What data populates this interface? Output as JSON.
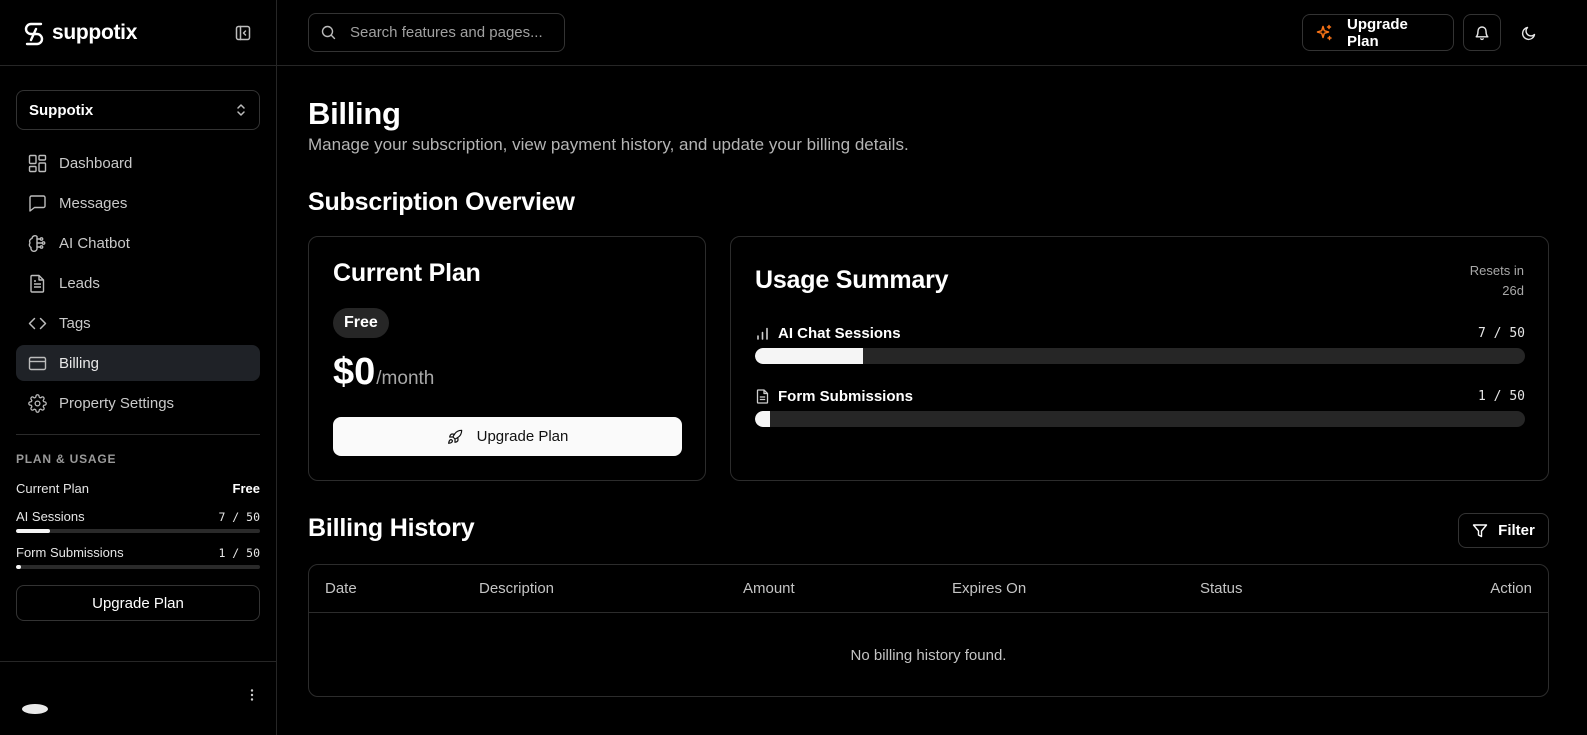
{
  "brand": {
    "name": "suppotix"
  },
  "workspace": {
    "name": "Suppotix"
  },
  "nav": [
    {
      "label": "Dashboard",
      "icon": "dashboard-icon"
    },
    {
      "label": "Messages",
      "icon": "message-square-icon"
    },
    {
      "label": "AI Chatbot",
      "icon": "brain-icon"
    },
    {
      "label": "Leads",
      "icon": "file-text-icon"
    },
    {
      "label": "Tags",
      "icon": "code-icon"
    },
    {
      "label": "Billing",
      "icon": "credit-card-icon",
      "active": true
    },
    {
      "label": "Property Settings",
      "icon": "gear-icon"
    }
  ],
  "plan_usage": {
    "title": "PLAN & USAGE",
    "current_plan_label": "Current Plan",
    "current_plan_value": "Free",
    "ai_sessions_label": "AI Sessions",
    "ai_sessions_value": "7 / 50",
    "ai_sessions_fraction": 0.14,
    "form_submissions_label": "Form Submissions",
    "form_submissions_value": "1 / 50",
    "form_submissions_fraction": 0.02,
    "upgrade_label": "Upgrade Plan"
  },
  "header": {
    "search_placeholder": "Search features and pages...",
    "upgrade_label": "Upgrade Plan",
    "accent_color": "#f97316"
  },
  "page": {
    "title": "Billing",
    "subtitle": "Manage your subscription, view payment history, and update your billing details."
  },
  "subscription": {
    "section_title": "Subscription Overview",
    "plan_card": {
      "title": "Current Plan",
      "badge": "Free",
      "price": "$0",
      "period": "/month",
      "button": "Upgrade Plan"
    },
    "usage_card": {
      "title": "Usage Summary",
      "resets_label": "Resets in",
      "resets_value": "26d",
      "items": [
        {
          "label": "AI Chat Sessions",
          "count": "7 / 50",
          "fraction": 0.14
        },
        {
          "label": "Form Submissions",
          "count": "1 / 50",
          "fraction": 0.02
        }
      ]
    }
  },
  "history": {
    "section_title": "Billing History",
    "filter_label": "Filter",
    "columns": [
      "Date",
      "Description",
      "Amount",
      "Expires On",
      "Status",
      "Action"
    ],
    "empty_text": "No billing history found."
  }
}
